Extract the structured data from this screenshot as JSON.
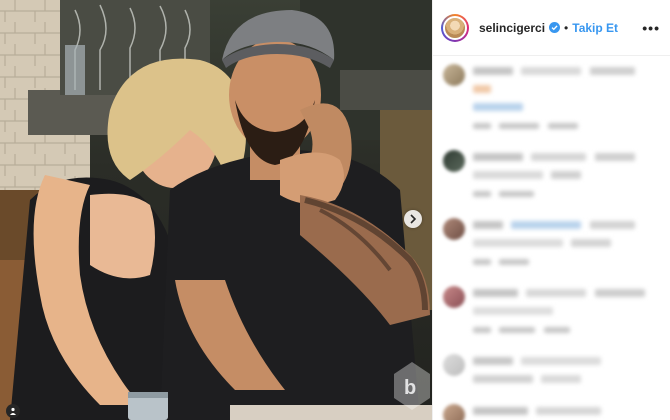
{
  "post": {
    "username": "selincigerci",
    "separator": "•",
    "follow_label": "Takip Et",
    "more_label": "•••",
    "verified": true,
    "photo_description_icon": "photo",
    "next_icon": "chevron-right-icon",
    "tag_icon": "user-tag-icon"
  },
  "colors": {
    "accent": "#3897f0",
    "text": "#262626",
    "border": "#efefef"
  }
}
